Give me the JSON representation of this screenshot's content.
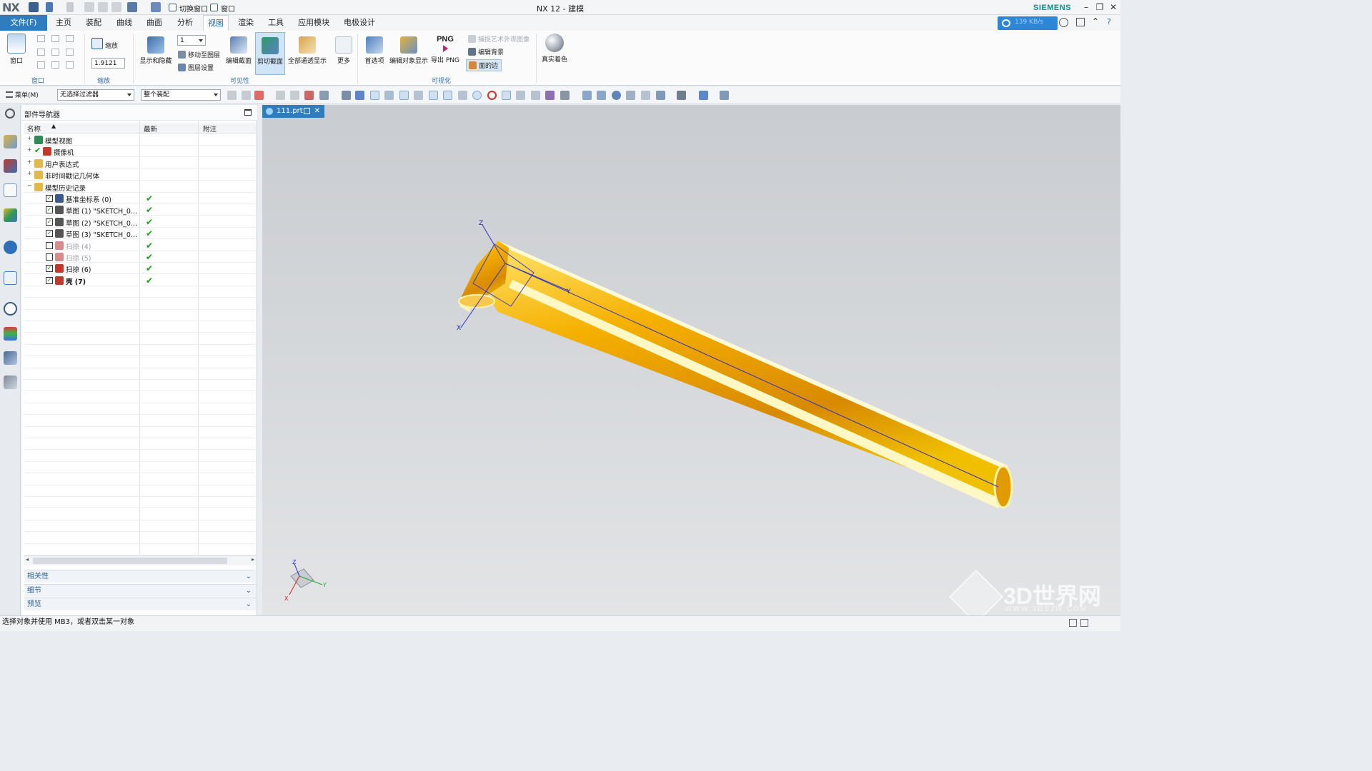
{
  "window": {
    "title": "NX 12 - 建模",
    "logo": "NX",
    "brand": "SIEMENS"
  },
  "quick_access": {
    "switch_window": "切换窗口",
    "window": "窗口"
  },
  "menu": {
    "file": "文件(F)",
    "tabs": [
      "主页",
      "装配",
      "曲线",
      "曲面",
      "分析",
      "视图",
      "渲染",
      "工具",
      "应用模块",
      "电极设计"
    ],
    "active_tab": "视图",
    "network_speed": "139 KB/s"
  },
  "ribbon": {
    "window_btn": "窗口",
    "zoom_btn": "缩放",
    "zoom_value": "1.9121",
    "show_hide": "显示和隐藏",
    "layer_value": "1",
    "move_to_layer": "移动至图层",
    "layer_settings": "图层设置",
    "edit_section": "编辑截面",
    "clip_section": "剪切截面",
    "all_pass_display": "全部通透显示",
    "more": "更多",
    "preferences": "首选项",
    "edit_object_display": "编辑对象显示",
    "export_png_icon": "PNG",
    "export_png": "导出 PNG",
    "capture_art": "捕捉艺术外观图像",
    "edit_background": "编辑背景",
    "face_edges": "面的边",
    "true_shading": "真实着色",
    "groups": {
      "window": "窗口",
      "zoom": "缩放",
      "visibility": "可见性",
      "visualization": "可视化"
    }
  },
  "toolbar": {
    "menu": "菜单(M)",
    "filter": "无选择过滤器",
    "assembly": "整个装配"
  },
  "navigator": {
    "title": "部件导航器",
    "columns": [
      "名称",
      "最新",
      "附注"
    ],
    "rows": [
      {
        "label": "模型视图",
        "level": 0,
        "expand": "+",
        "checked": null,
        "latest": false,
        "dim": false,
        "icon_color": "#2e8b57"
      },
      {
        "label": "摄像机",
        "level": 0,
        "expand": "+",
        "checked": null,
        "latest": false,
        "dim": false,
        "icon_color": "#c0392b",
        "tick": true
      },
      {
        "label": "用户表达式",
        "level": 0,
        "expand": "+",
        "checked": null,
        "latest": false,
        "dim": false,
        "icon_color": "#e0b84c"
      },
      {
        "label": "非时间戳记几何体",
        "level": 0,
        "expand": "+",
        "checked": null,
        "latest": false,
        "dim": false,
        "icon_color": "#e0b84c"
      },
      {
        "label": "模型历史记录",
        "level": 0,
        "expand": "−",
        "checked": null,
        "latest": false,
        "dim": false,
        "icon_color": "#e0b84c"
      },
      {
        "label": "基准坐标系 (0)",
        "level": 1,
        "expand": "",
        "checked": true,
        "latest": true,
        "dim": false,
        "icon_color": "#3a5a8c"
      },
      {
        "label": "草图 (1) \"SKETCH_0...",
        "level": 1,
        "expand": "",
        "checked": true,
        "latest": true,
        "dim": false,
        "icon_color": "#555"
      },
      {
        "label": "草图 (2) \"SKETCH_0...",
        "level": 1,
        "expand": "",
        "checked": true,
        "latest": true,
        "dim": false,
        "icon_color": "#555"
      },
      {
        "label": "草图 (3) \"SKETCH_0...",
        "level": 1,
        "expand": "",
        "checked": true,
        "latest": true,
        "dim": false,
        "icon_color": "#555"
      },
      {
        "label": "扫掠 (4)",
        "level": 1,
        "expand": "",
        "checked": false,
        "latest": true,
        "dim": true,
        "icon_color": "#d98a8a"
      },
      {
        "label": "扫掠 (5)",
        "level": 1,
        "expand": "",
        "checked": false,
        "latest": true,
        "dim": true,
        "icon_color": "#d98a8a"
      },
      {
        "label": "扫掠 (6)",
        "level": 1,
        "expand": "",
        "checked": true,
        "latest": true,
        "dim": false,
        "icon_color": "#c0392b"
      },
      {
        "label": "壳 (7)",
        "level": 1,
        "expand": "",
        "checked": true,
        "latest": true,
        "dim": false,
        "bold": true,
        "icon_color": "#c0392b"
      }
    ],
    "latest_mark": "✔",
    "sections": [
      "相关性",
      "细节",
      "预览"
    ]
  },
  "viewport": {
    "tab": "111.prt",
    "axis_labels": {
      "x": "X",
      "y": "Y",
      "z": "Z"
    }
  },
  "status": {
    "message": "选择对象并使用 MB3，或者双击某一对象"
  },
  "watermark": {
    "text": "3D世界网",
    "url": "WWW.3DSJW.COM"
  }
}
